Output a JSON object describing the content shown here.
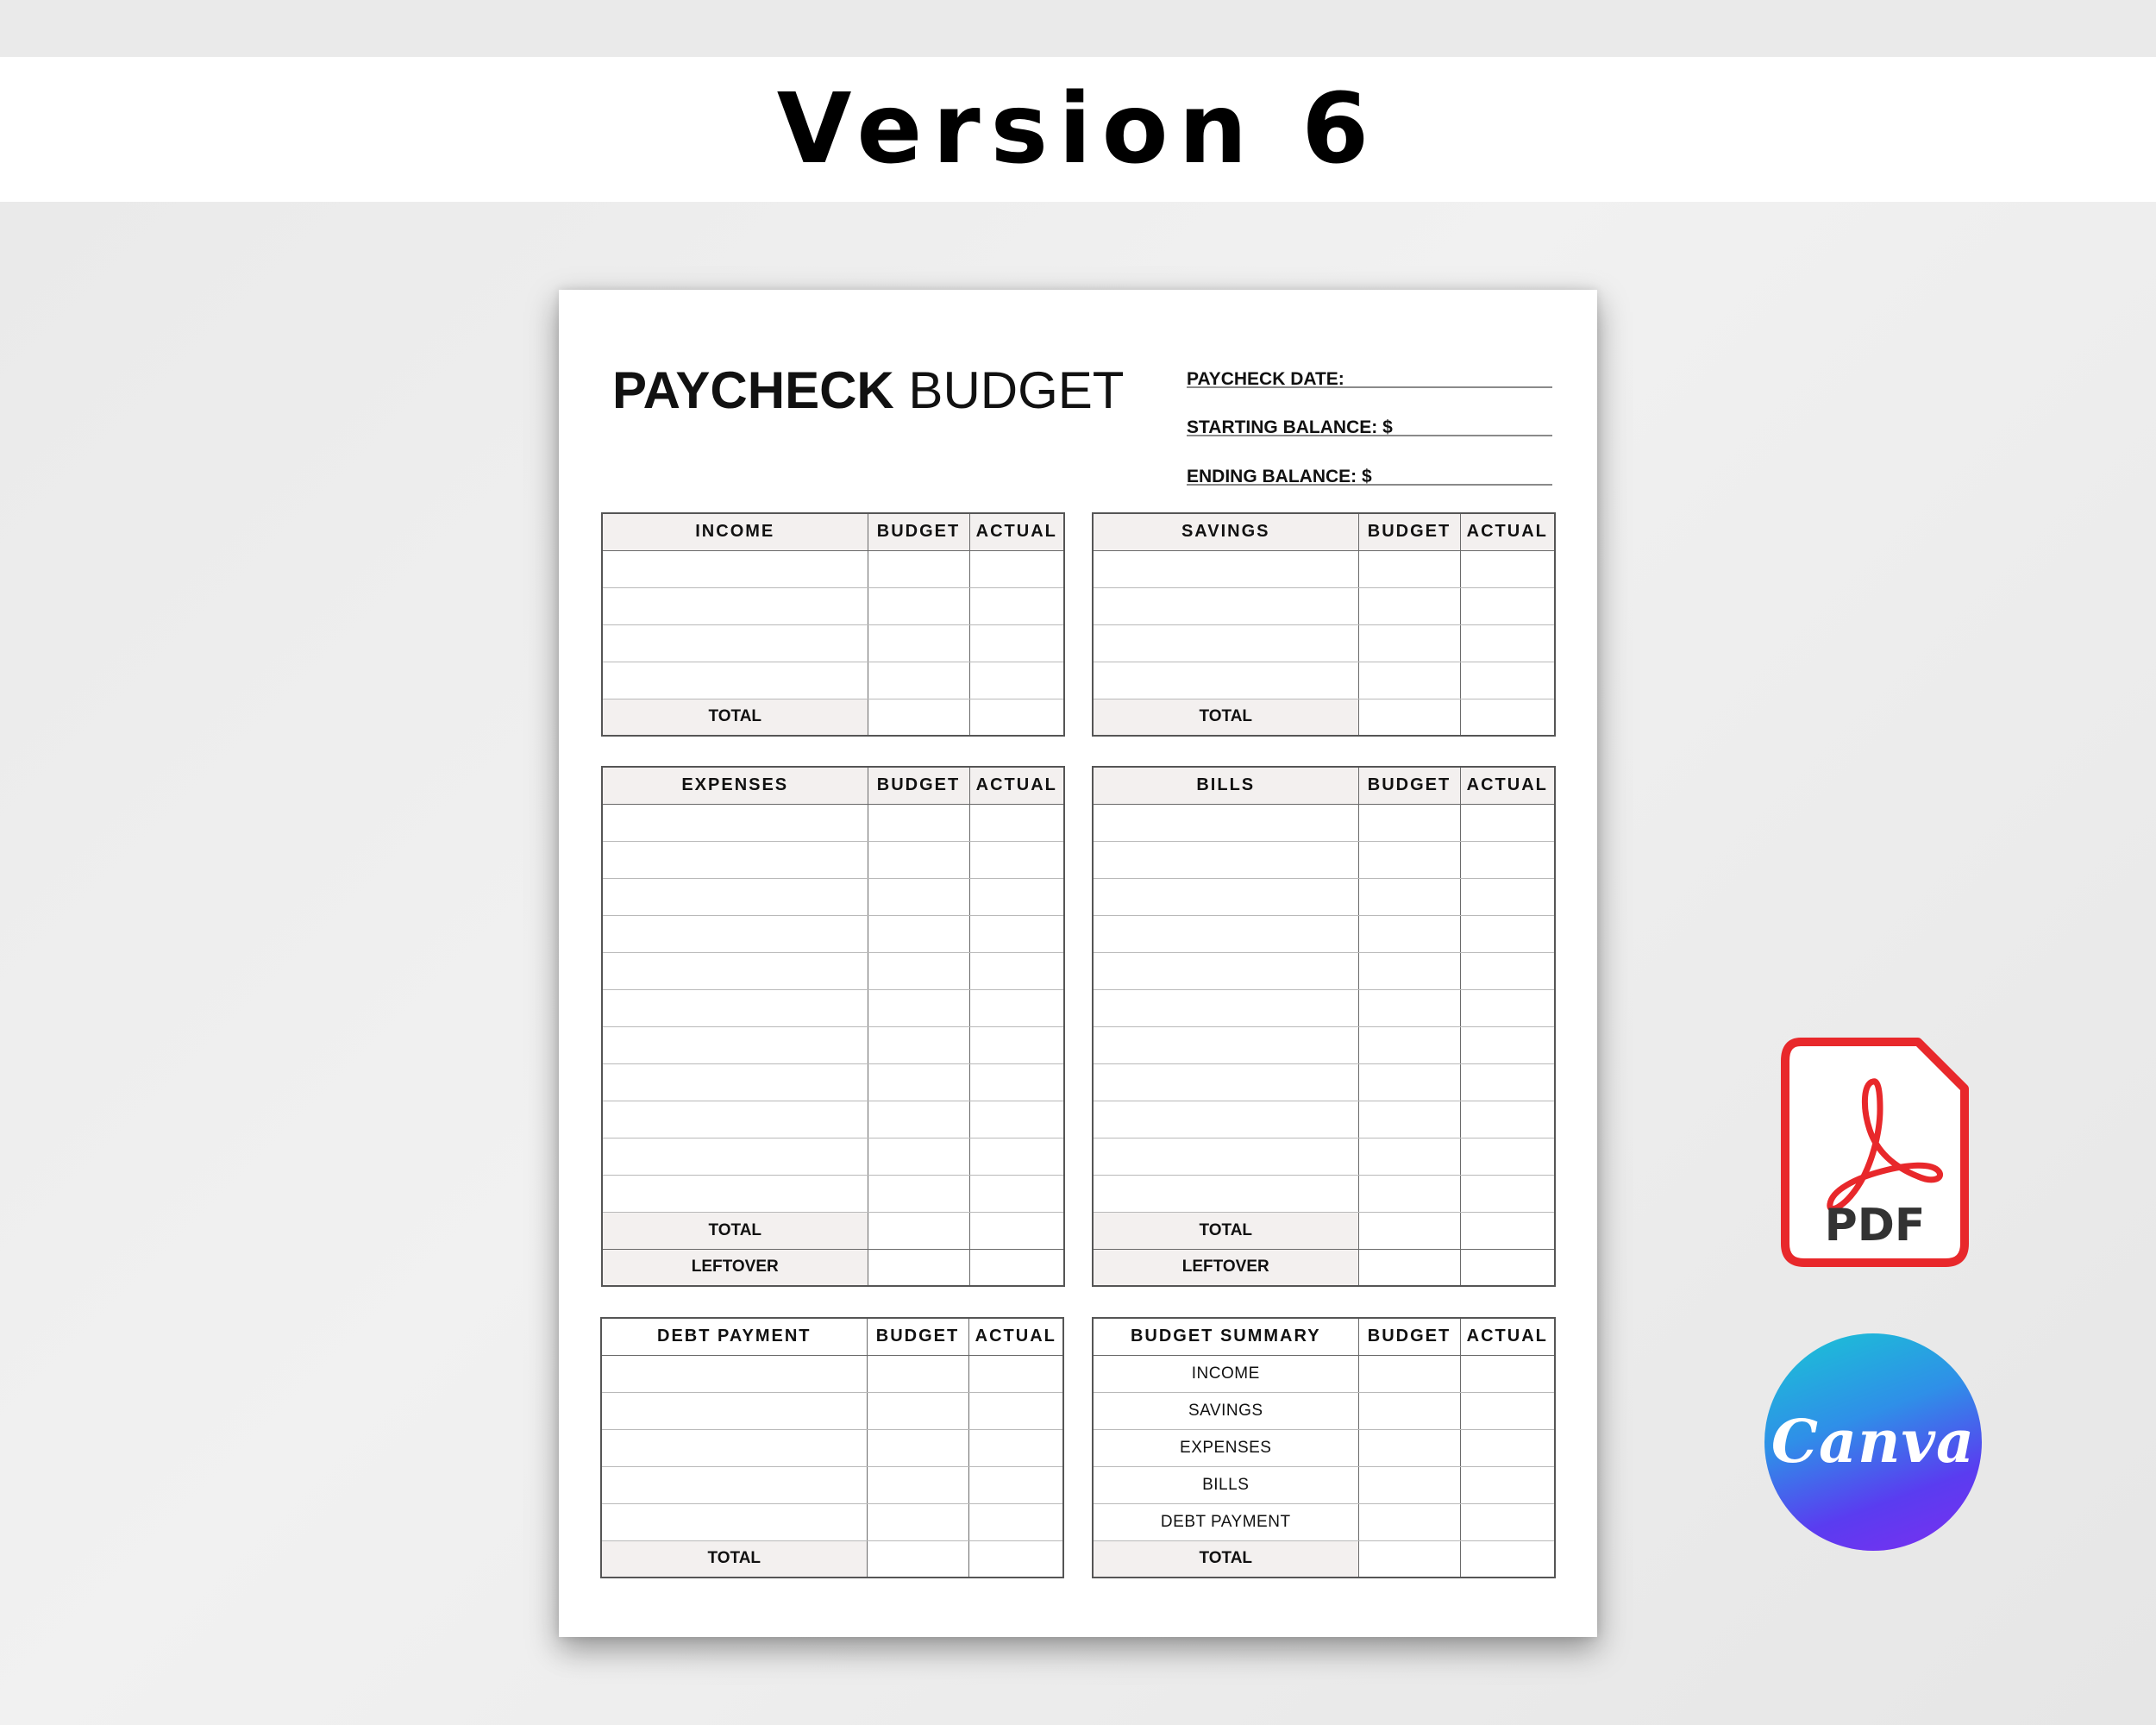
{
  "banner": {
    "title": "Version 6"
  },
  "document": {
    "title_bold": "PAYCHECK",
    "title_light": "BUDGET",
    "fields": [
      {
        "label": "PAYCHECK DATE:"
      },
      {
        "label": "STARTING BALANCE: $"
      },
      {
        "label": "ENDING BALANCE: $"
      }
    ]
  },
  "tables": {
    "income": {
      "header": "INCOME",
      "col_budget": "BUDGET",
      "col_actual": "ACTUAL",
      "total": "TOTAL"
    },
    "savings": {
      "header": "SAVINGS",
      "col_budget": "BUDGET",
      "col_actual": "ACTUAL",
      "total": "TOTAL"
    },
    "expenses": {
      "header": "EXPENSES",
      "col_budget": "BUDGET",
      "col_actual": "ACTUAL",
      "total": "TOTAL",
      "leftover": "LEFTOVER"
    },
    "bills": {
      "header": "BILLS",
      "col_budget": "BUDGET",
      "col_actual": "ACTUAL",
      "total": "TOTAL",
      "leftover": "LEFTOVER"
    },
    "debt": {
      "header": "DEBT PAYMENT",
      "col_budget": "BUDGET",
      "col_actual": "ACTUAL",
      "total": "TOTAL"
    },
    "summary": {
      "header": "BUDGET SUMMARY",
      "col_budget": "BUDGET",
      "col_actual": "ACTUAL",
      "rows": [
        "INCOME",
        "SAVINGS",
        "EXPENSES",
        "BILLS",
        "DEBT PAYMENT"
      ],
      "total": "TOTAL"
    }
  },
  "badges": {
    "pdf_label": "PDF",
    "canva_label": "Canva",
    "pdf_color": "#e8282b"
  }
}
